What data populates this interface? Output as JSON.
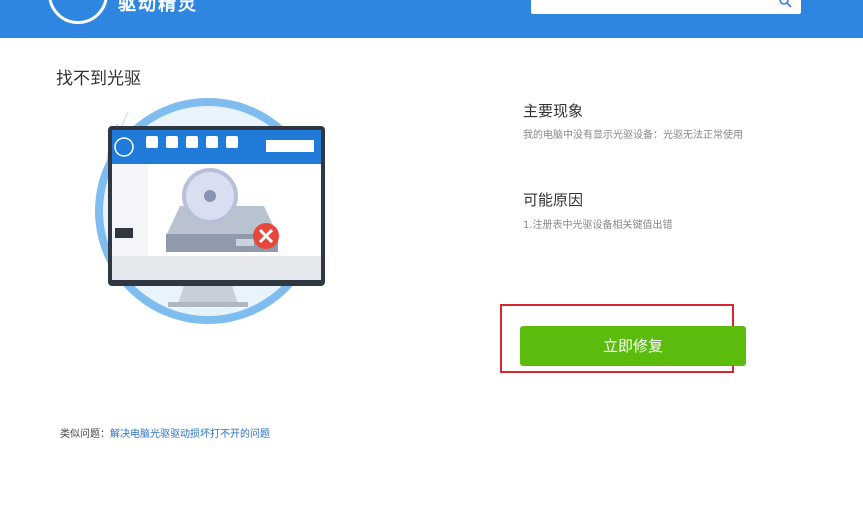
{
  "header": {
    "app_title": "驱动精灵"
  },
  "page": {
    "title": "找不到光驱"
  },
  "symptom": {
    "title": "主要现象",
    "description": "我的电脑中没有显示光驱设备：光驱无法正常使用"
  },
  "cause": {
    "title": "可能原因",
    "description": "1.注册表中光驱设备相关键值出错"
  },
  "action": {
    "fix_label": "立即修复"
  },
  "related": {
    "prefix": "类似问题：",
    "link_text": "解决电脑光驱驱动损坏打不开的问题"
  },
  "colors": {
    "header_bg": "#2f86e0",
    "fix_button": "#5bbc0e",
    "highlight_border": "#d8282e",
    "link": "#2a71c8"
  },
  "icons": [
    "app-logo-icon",
    "search-icon",
    "cd-drive-icon",
    "error-x-icon",
    "monitor-icon"
  ]
}
